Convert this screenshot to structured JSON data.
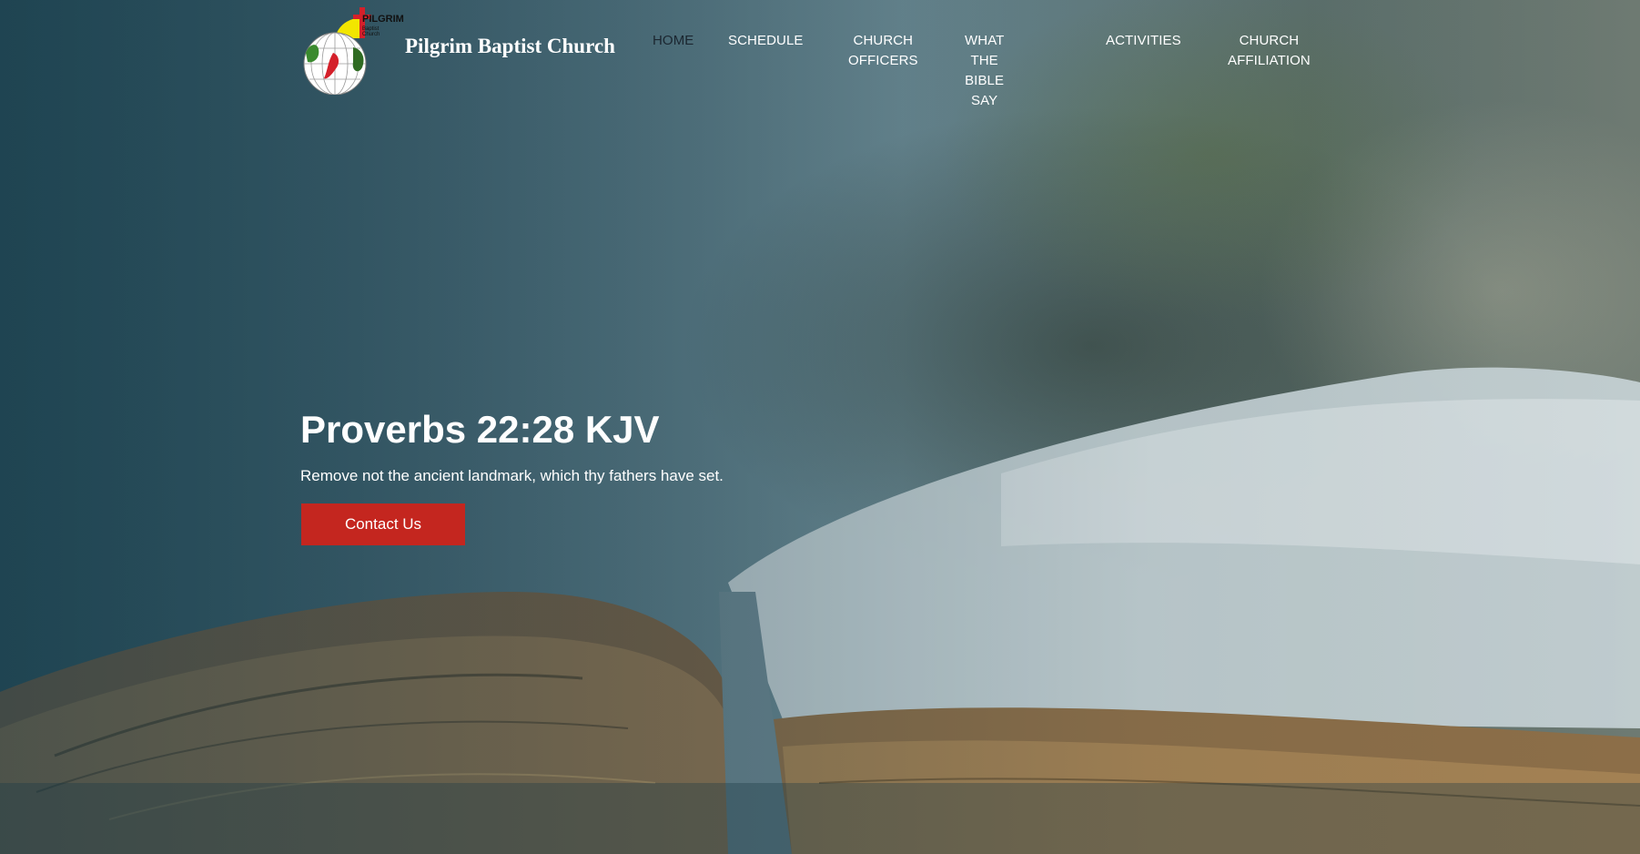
{
  "site": {
    "logo": {
      "line1": "PILGRIM",
      "line2": "Baptist",
      "line3": "Church",
      "colors": {
        "cross": "#d4202a",
        "sun": "#f2e600",
        "land": "#3a8a2e",
        "map": "#d4202a"
      }
    },
    "name": "Pilgrim Baptist Church"
  },
  "nav": {
    "home": "HOME",
    "schedule": "SCHEDULE",
    "officers_l1": "CHURCH",
    "officers_l2": "OFFICERS",
    "bible_l1": "WHAT THE BIBLE",
    "bible_l2": "SAY",
    "activities": "ACTIVITIES",
    "affiliation_l1": "CHURCH",
    "affiliation_l2": "AFFILIATION"
  },
  "hero": {
    "title": "Proverbs 22:28 KJV",
    "text": "Remove not the ancient landmark, which thy fathers have set.",
    "cta_label": "Contact Us",
    "cta_color": "#c4261f"
  }
}
